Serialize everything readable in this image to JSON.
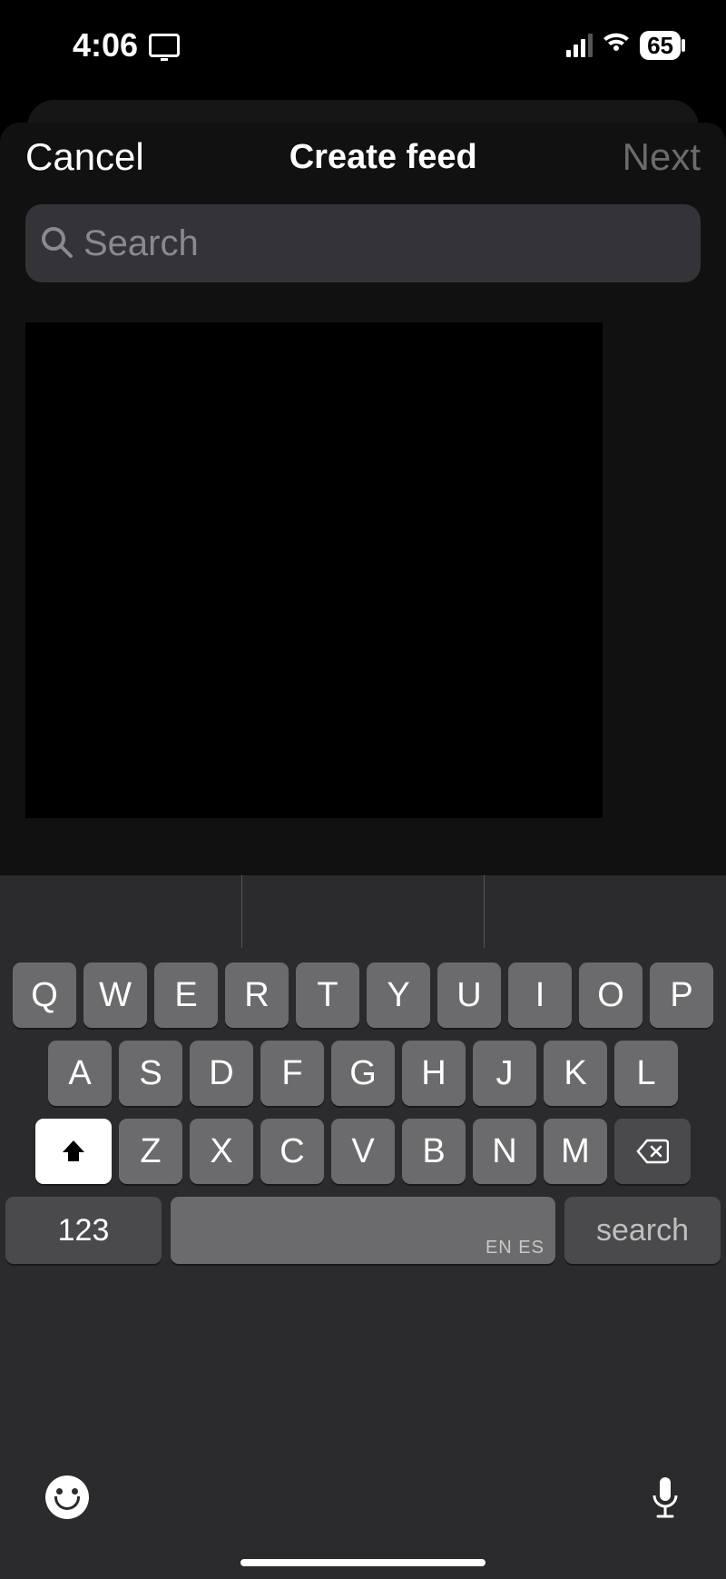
{
  "status": {
    "time": "4:06",
    "battery": "65"
  },
  "sheet": {
    "cancel": "Cancel",
    "title": "Create feed",
    "next": "Next",
    "search_placeholder": "Search",
    "search_value": ""
  },
  "keyboard": {
    "row1": [
      "Q",
      "W",
      "E",
      "R",
      "T",
      "Y",
      "U",
      "I",
      "O",
      "P"
    ],
    "row2": [
      "A",
      "S",
      "D",
      "F",
      "G",
      "H",
      "J",
      "K",
      "L"
    ],
    "row3": [
      "Z",
      "X",
      "C",
      "V",
      "B",
      "N",
      "M"
    ],
    "numKey": "123",
    "spaceHint": "EN ES",
    "searchKey": "search"
  }
}
